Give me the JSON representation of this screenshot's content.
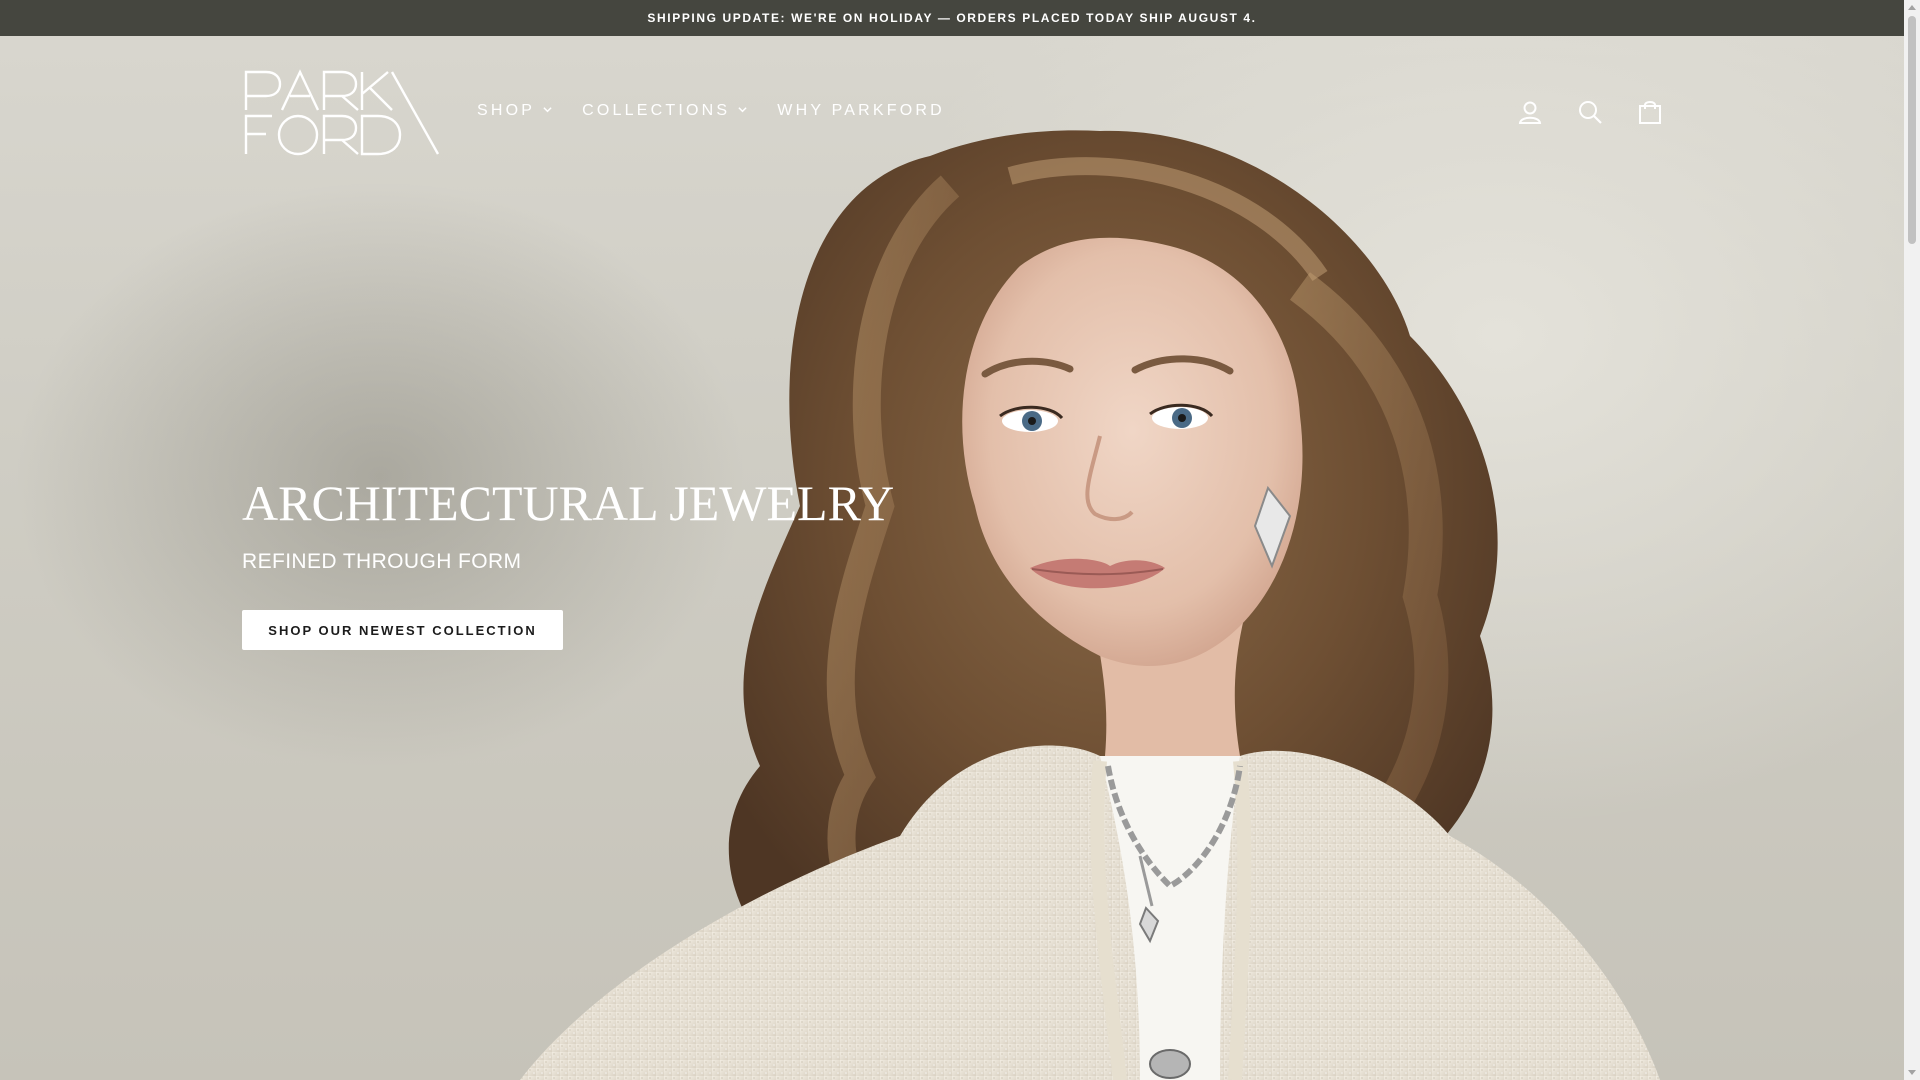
{
  "announcement": {
    "text": "SHIPPING UPDATE: WE'RE ON HOLIDAY — ORDERS PLACED TODAY SHIP AUGUST 4."
  },
  "header": {
    "logo_text": "PARK FORD",
    "nav": [
      {
        "label": "SHOP",
        "has_dropdown": true
      },
      {
        "label": "COLLECTIONS",
        "has_dropdown": true
      },
      {
        "label": "WHY PARKFORD",
        "has_dropdown": false
      }
    ],
    "icons": [
      "account-icon",
      "search-icon",
      "cart-icon"
    ]
  },
  "hero": {
    "title": "ARCHITECTURAL JEWELRY",
    "subtitle": "REFINED THROUGH FORM",
    "cta_label": "SHOP OUR NEWEST COLLECTION"
  },
  "colors": {
    "announcement_bg": "#45463f",
    "text_light": "#ffffff",
    "cta_bg": "#ffffff",
    "cta_text": "#1c1c1c"
  }
}
